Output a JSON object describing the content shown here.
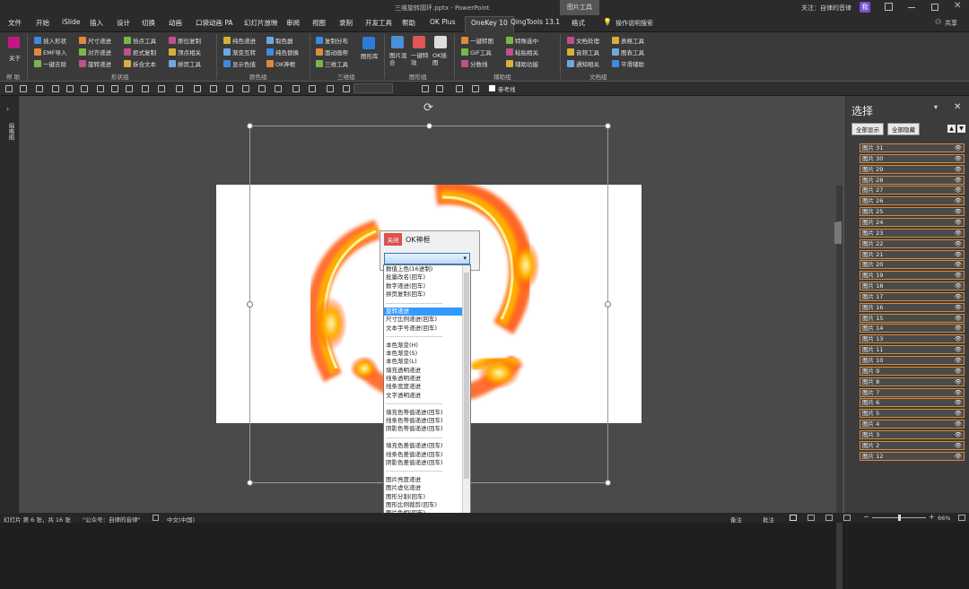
{
  "titlebar": {
    "doc_title": "三维旋转圆环.pptx - PowerPoint",
    "context_tab": "图片工具",
    "follow_text": "关注：自律的音律",
    "avatar": "我"
  },
  "menu": {
    "tabs": [
      "文件",
      "开始",
      "iSlide",
      "插入",
      "设计",
      "切换",
      "动画",
      "口袋动画 PA",
      "幻灯片放映",
      "审阅",
      "视图",
      "录制",
      "开发工具",
      "帮助",
      "OK Plus",
      "OneKey 10",
      "QingTools 13.1",
      "格式"
    ],
    "search": "操作说明搜索",
    "share": "共享"
  },
  "ribbon": {
    "about": {
      "label": "关于",
      "group": "帮 助"
    },
    "shape_group": {
      "label": "形状组",
      "col1": [
        "插入形状",
        "EMF导入",
        "一键去除"
      ],
      "col2": [
        "尺寸递进",
        "对齐递进",
        "旋转递进"
      ],
      "col3": [
        "拾点工具",
        "拒式复制",
        "拆合文本"
      ],
      "col4": [
        "原位复制",
        "顶点相关",
        "拼页工具"
      ]
    },
    "color_group": {
      "label": "颜色组",
      "col1": [
        "纯色递进",
        "渐变互转",
        "显示色值"
      ],
      "col2": [
        "取色器",
        "纯色替换",
        "OK神框"
      ]
    },
    "3d_group": {
      "label": "三维组",
      "items": [
        "复制分布",
        "面动画帮",
        "三维工具"
      ],
      "big": "图形库"
    },
    "image_group": {
      "label": "图形组",
      "items": [
        "图片混合",
        "一键特效",
        "OK插图"
      ]
    },
    "aux_group": {
      "label": "辅助组",
      "col1": [
        "一键转图",
        "GIF工具",
        "分数线"
      ],
      "col2": [
        "特殊选中",
        "粘贴相关",
        "辅助功能"
      ]
    },
    "doc_group": {
      "label": "文档组",
      "col1": [
        "文档处理",
        "音频工具",
        "通知相关"
      ],
      "col2": [
        "表格工具",
        "图表工具",
        "平滑辅助"
      ]
    }
  },
  "qat": {
    "ref_line": "参考线"
  },
  "leftbar": {
    "label": "缩略图"
  },
  "dialog": {
    "close": "关闭",
    "title": "OK神框"
  },
  "dropdown_options": [
    "数值上色(16进制)",
    "批量改名(回车)",
    "数字递进(回车)",
    "拼页复制(回车)",
    "---------------------------",
    "旋转递进",
    "尺寸比例递进(回车)",
    "文本字号递进(回车)",
    "---------------------------",
    "本色渐变(H)",
    "本色渐变(S)",
    "本色渐变(L)",
    "填充透明递进",
    "线条透明递进",
    "线条宽度递进",
    "文字透明递进",
    "---------------------------",
    "填充色等值递进(回车)",
    "线条色等值递进(回车)",
    "阴影色等值递进(回车)",
    "---------------------------",
    "填充色差值递进(回车)",
    "线条色差值递进(回车)",
    "阴影色差值递进(回车)",
    "---------------------------",
    "图片亮度递进",
    "图片虚化递进",
    "图形分割(回车)",
    "图形比例裁剪(回车)",
    "图片色相(回车)"
  ],
  "selected_option": "旋转递进",
  "panel": {
    "title": "选择",
    "show_all": "全部显示",
    "hide_all": "全部隐藏",
    "layers": [
      "图片 31",
      "图片 30",
      "图片 29",
      "图片 28",
      "图片 27",
      "图片 26",
      "图片 25",
      "图片 24",
      "图片 23",
      "图片 22",
      "图片 21",
      "图片 20",
      "图片 19",
      "图片 18",
      "图片 17",
      "图片 16",
      "图片 15",
      "图片 14",
      "图片 13",
      "图片 11",
      "图片 10",
      "图片 9",
      "图片 8",
      "图片 7",
      "图片 6",
      "图片 5",
      "图片 4",
      "图片 3",
      "图片 2",
      "图片 12"
    ]
  },
  "statusbar": {
    "slide_info": "幻灯片 第 6 张，共 16 张",
    "public_account": "\"公众号：自律的音律\"",
    "language": "中文(中国)",
    "notes": "备注",
    "comments": "批注",
    "zoom": "66%"
  },
  "colors": {
    "accent": "#d88b3a",
    "close": "#d9534f",
    "fire_inner": "#ffe680",
    "fire_outer": "#ff4d00"
  }
}
